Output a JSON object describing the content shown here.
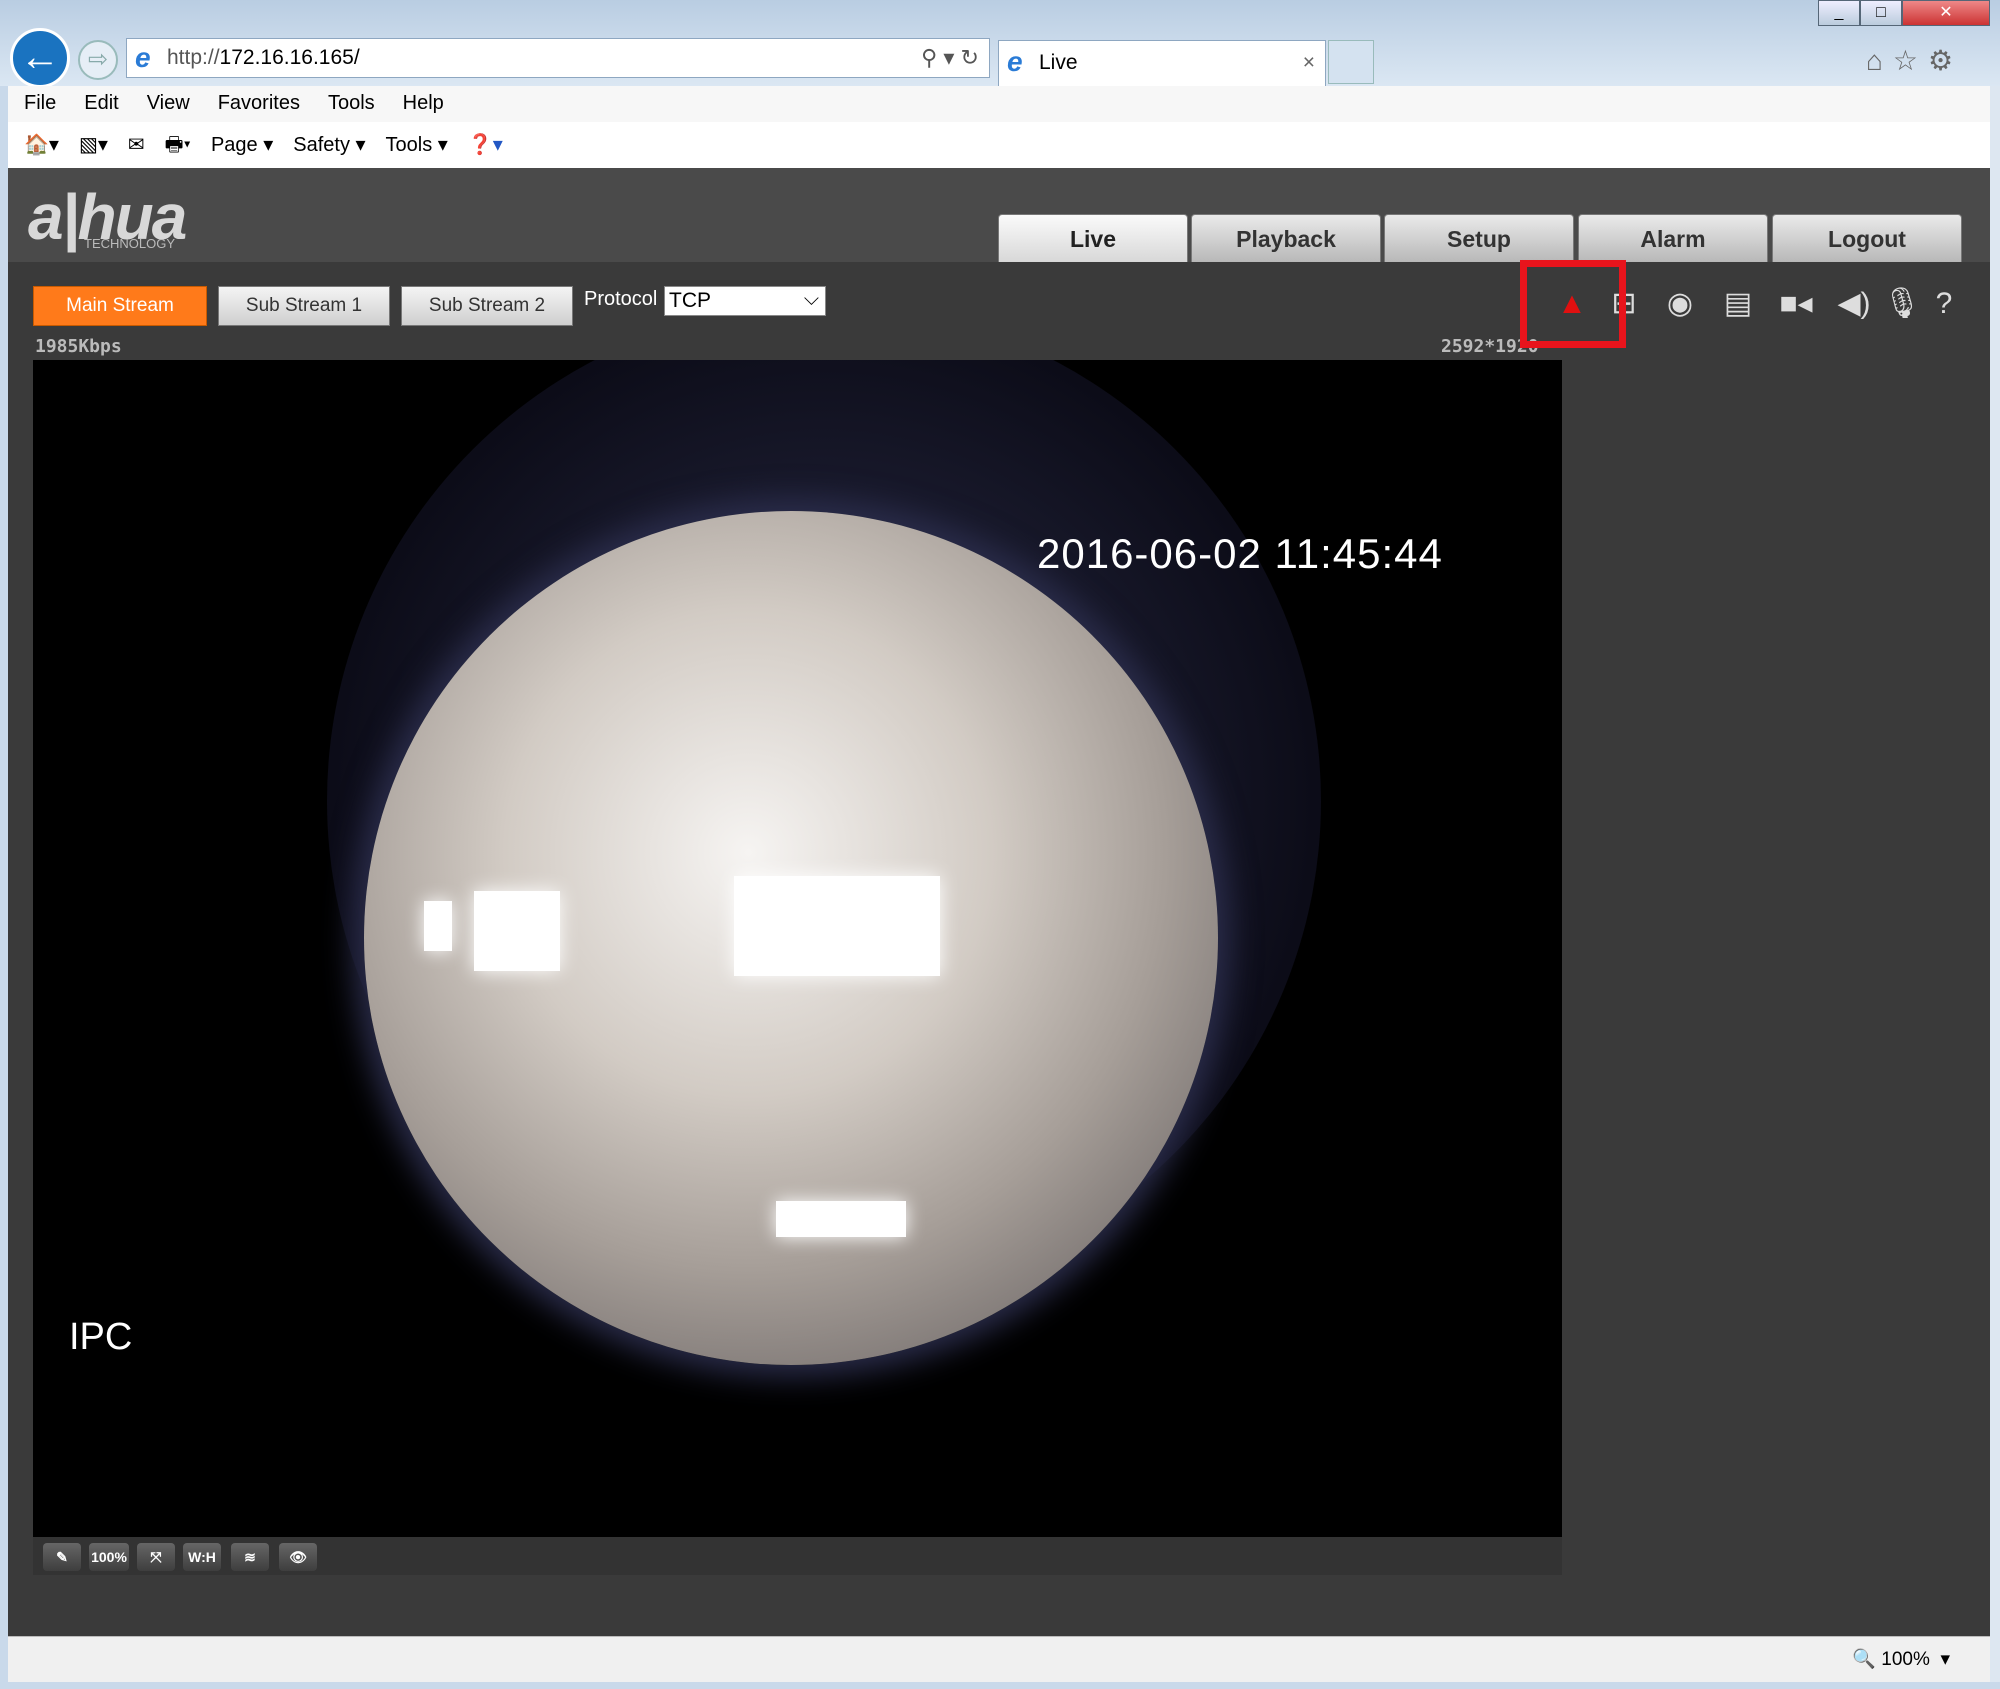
{
  "browser": {
    "url_prefix": "http://",
    "url_host": "172.16.16.165/",
    "tab_title": "Live",
    "close": "×"
  },
  "menu": [
    "File",
    "Edit",
    "View",
    "Favorites",
    "Tools",
    "Help"
  ],
  "command_bar": [
    "Page ▾",
    "Safety ▾",
    "Tools ▾"
  ],
  "app": {
    "logo": "alhua",
    "logo_sub": "TECHNOLOGY",
    "nav_tabs": [
      "Live",
      "Playback",
      "Setup",
      "Alarm",
      "Logout"
    ],
    "streams": [
      "Main Stream",
      "Sub Stream 1",
      "Sub Stream 2"
    ],
    "protocol_label": "Protocol",
    "protocol_value": "TCP",
    "bitrate": "1985Kbps",
    "resolution": "2592*1920",
    "video": {
      "timestamp": "2016-06-02 11:45:44",
      "channel": "IPC"
    },
    "toolbar_icons": [
      "alarm-light-icon",
      "zoom-region-icon",
      "snapshot-icon",
      "triple-snapshot-icon",
      "record-icon",
      "audio-icon",
      "microphone-icon",
      "help-icon"
    ],
    "highlight_color": "#e8141c",
    "active_stream_color": "#ff7a1a",
    "controls": {
      "zoom_100": "100%",
      "wh": "W:H"
    }
  },
  "status": {
    "zoom": "100%"
  }
}
